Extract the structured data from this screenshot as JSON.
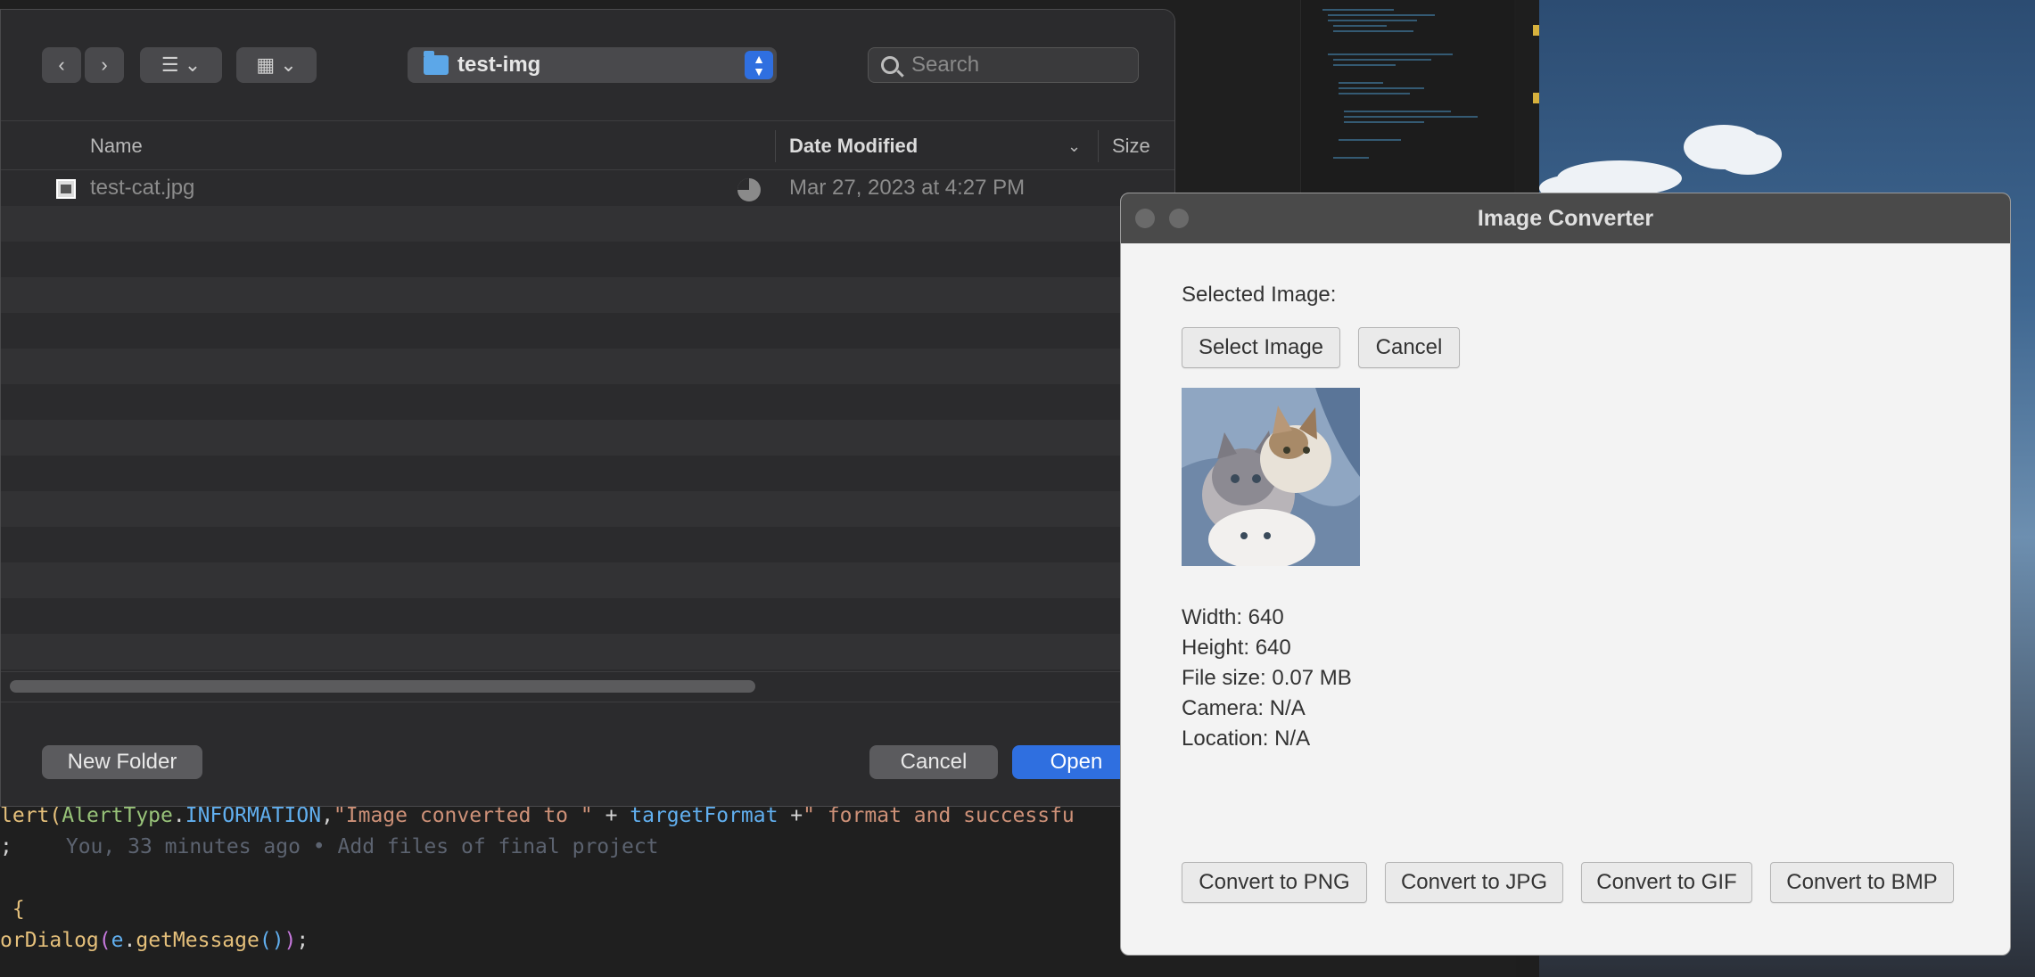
{
  "editor": {
    "code": [
      {
        "parts": [
          {
            "t": "lert(",
            "c": "c-yellow"
          },
          {
            "t": "AlertType",
            "c": "c-green"
          },
          {
            "t": ".",
            "c": "c-white"
          },
          {
            "t": "INFORMATION",
            "c": "c-blue"
          },
          {
            "t": ",",
            "c": "c-white"
          },
          {
            "t": "\"Image converted to \"",
            "c": "c-orange"
          },
          {
            "t": " + ",
            "c": "c-white"
          },
          {
            "t": "targetFormat",
            "c": "c-blue"
          },
          {
            "t": " +",
            "c": "c-white"
          },
          {
            "t": "\" format and successfu",
            "c": "c-orange"
          }
        ]
      },
      {
        "parts": [
          {
            "t": ";",
            "c": "c-white"
          }
        ],
        "blame": "You, 33 minutes ago • Add files of final project"
      },
      {
        "parts": []
      },
      {
        "parts": [
          {
            "t": " {",
            "c": "c-yellow"
          }
        ]
      },
      {
        "parts": [
          {
            "t": "orDialog",
            "c": "c-yellow"
          },
          {
            "t": "(",
            "c": "c-purple"
          },
          {
            "t": "e",
            "c": "c-blue"
          },
          {
            "t": ".",
            "c": "c-white"
          },
          {
            "t": "getMessage",
            "c": "c-yellow"
          },
          {
            "t": "()",
            "c": "c-blue"
          },
          {
            "t": ")",
            "c": "c-purple"
          },
          {
            "t": ";",
            "c": "c-white"
          }
        ]
      }
    ]
  },
  "file_dialog": {
    "nav": {
      "back": "‹",
      "forward": "›"
    },
    "view_icons": {
      "list": "☰",
      "grid": "▦",
      "chevron": "⌄"
    },
    "path": "test-img",
    "search_placeholder": "Search",
    "columns": {
      "name": "Name",
      "date_modified": "Date Modified",
      "size": "Size"
    },
    "files": [
      {
        "name": "test-cat.jpg",
        "date": "Mar 27, 2023 at 4:27 PM"
      }
    ],
    "new_folder_label": "New Folder",
    "cancel_label": "Cancel",
    "open_label": "Open"
  },
  "converter": {
    "title": "Image Converter",
    "selected_label": "Selected Image:",
    "select_button": "Select Image",
    "cancel_button": "Cancel",
    "info": {
      "width": "Width: 640",
      "height": "Height: 640",
      "file_size": "File size: 0.07 MB",
      "camera": "Camera: N/A",
      "location": "Location: N/A"
    },
    "convert_buttons": [
      "Convert to PNG",
      "Convert to JPG",
      "Convert to GIF",
      "Convert to BMP"
    ]
  },
  "colors": {
    "accent": "#2f6fe0",
    "dialog_bg": "#2b2b2d",
    "converter_bg": "#f3f3f3"
  }
}
